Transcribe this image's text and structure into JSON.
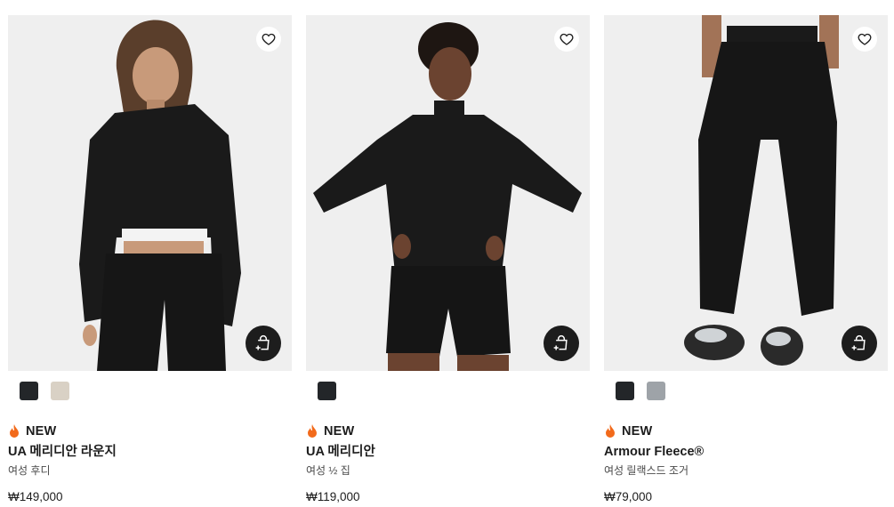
{
  "accent_badge_color": "#f26a1b",
  "products": [
    {
      "badge": "NEW",
      "name": "UA 메리디안 라운지",
      "category": "여성 후디",
      "price": "₩149,000",
      "swatches": [
        {
          "color": "#232629",
          "name": "black"
        },
        {
          "color": "#d9d1c5",
          "name": "beige"
        }
      ]
    },
    {
      "badge": "NEW",
      "name": "UA 메리디안",
      "category": "여성 ½ 집",
      "price": "₩119,000",
      "swatches": [
        {
          "color": "#232629",
          "name": "black"
        }
      ]
    },
    {
      "badge": "NEW",
      "name": "Armour Fleece®",
      "category": "여성 릴랙스드 조거",
      "price": "₩79,000",
      "swatches": [
        {
          "color": "#232629",
          "name": "black"
        },
        {
          "color": "#9ea3a8",
          "name": "grey"
        }
      ]
    }
  ],
  "icons": {
    "wishlist": "heart-outline-icon",
    "quick_add": "bag-plus-icon",
    "badge": "flame-icon"
  }
}
